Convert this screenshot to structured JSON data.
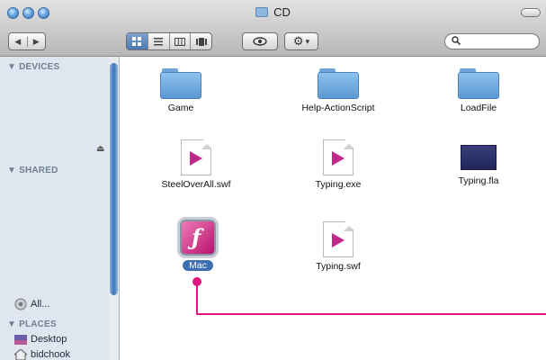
{
  "window": {
    "title": "CD"
  },
  "toolbar": {
    "back_icon": "◀",
    "forward_icon": "▶",
    "views": [
      "icon-view",
      "list-view",
      "column-view",
      "coverflow-view"
    ],
    "quicklook_icon": "eye-icon",
    "action_icon": "gear-icon",
    "action_caret": "▾",
    "search_placeholder": ""
  },
  "sidebar": {
    "devices_label": "▼ DEVICES",
    "shared_label": "▼ SHARED",
    "all_label": "All...",
    "places_label": "▼ PLACES",
    "places": [
      "Desktop",
      "bidchook"
    ]
  },
  "files": [
    {
      "name": "Game",
      "kind": "folder"
    },
    {
      "name": "Help-ActionScript",
      "kind": "folder"
    },
    {
      "name": "LoadFile",
      "kind": "folder"
    },
    {
      "name": "SteelOverAll.swf",
      "kind": "swf"
    },
    {
      "name": "Typing.exe",
      "kind": "swf"
    },
    {
      "name": "Typing.fla",
      "kind": "fla"
    },
    {
      "name": "Mac",
      "kind": "flash-app",
      "selected": true
    },
    {
      "name": "Typing.swf",
      "kind": "swf"
    }
  ],
  "colors": {
    "accent": "#e0167c",
    "selection": "#3d6fb0"
  }
}
